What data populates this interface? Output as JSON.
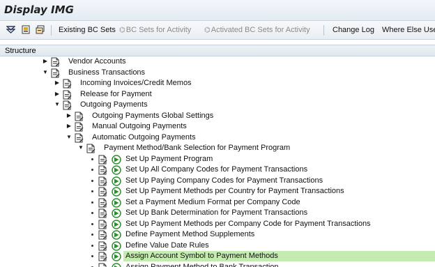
{
  "window": {
    "title": "Display IMG"
  },
  "toolbar": {
    "icons": [
      "expand-subtree-icon",
      "documentation-icon",
      "release-notes-icon"
    ],
    "buttons": [
      {
        "label": "Existing BC Sets",
        "enabled": true
      },
      {
        "label": "BC Sets for Activity",
        "enabled": false
      },
      {
        "label": "Activated BC Sets for Activity",
        "enabled": false
      },
      {
        "label": "Change Log",
        "enabled": true
      },
      {
        "label": "Where Else Used",
        "enabled": true
      }
    ]
  },
  "structure": {
    "header": "Structure",
    "nodes": [
      {
        "label": "Vendor Accounts",
        "level": 3,
        "state": "collapsed",
        "type": "folder"
      },
      {
        "label": "Business Transactions",
        "level": 3,
        "state": "expanded",
        "type": "folder"
      },
      {
        "label": "Incoming Invoices/Credit Memos",
        "level": 4,
        "state": "collapsed",
        "type": "folder"
      },
      {
        "label": "Release for Payment",
        "level": 4,
        "state": "collapsed",
        "type": "folder"
      },
      {
        "label": "Outgoing Payments",
        "level": 4,
        "state": "expanded",
        "type": "folder"
      },
      {
        "label": "Outgoing Payments Global Settings",
        "level": 5,
        "state": "collapsed",
        "type": "folder"
      },
      {
        "label": "Manual Outgoing Payments",
        "level": 5,
        "state": "collapsed",
        "type": "folder"
      },
      {
        "label": "Automatic Outgoing Payments",
        "level": 5,
        "state": "expanded",
        "type": "folder"
      },
      {
        "label": "Payment Method/Bank Selection for Payment Program",
        "level": 6,
        "state": "expanded",
        "type": "folder"
      },
      {
        "label": "Set Up Payment Program",
        "level": 7,
        "state": "leaf",
        "type": "activity"
      },
      {
        "label": "Set Up All Company Codes for Payment Transactions",
        "level": 7,
        "state": "leaf",
        "type": "activity"
      },
      {
        "label": "Set Up Paying Company Codes for Payment Transactions",
        "level": 7,
        "state": "leaf",
        "type": "activity"
      },
      {
        "label": "Set Up Payment Methods per Country for Payment Transactions",
        "level": 7,
        "state": "leaf",
        "type": "activity"
      },
      {
        "label": "Set a Payment Medium Format per Company Code",
        "level": 7,
        "state": "leaf",
        "type": "activity"
      },
      {
        "label": "Set Up Bank Determination for Payment Transactions",
        "level": 7,
        "state": "leaf",
        "type": "activity"
      },
      {
        "label": "Set Up Payment Methods per Company Code for Payment Transactions",
        "level": 7,
        "state": "leaf",
        "type": "activity"
      },
      {
        "label": "Define Payment Method Supplements",
        "level": 7,
        "state": "leaf",
        "type": "activity"
      },
      {
        "label": "Define Value Date Rules",
        "level": 7,
        "state": "leaf",
        "type": "activity"
      },
      {
        "label": "Assign Account Symbol to Payment Methods",
        "level": 7,
        "state": "leaf",
        "type": "activity",
        "selected": true
      },
      {
        "label": "Assign Payment Method to Bank Transaction",
        "level": 7,
        "state": "leaf",
        "type": "activity"
      }
    ]
  },
  "colors": {
    "selection": "#c4ecb0",
    "exec_icon": "#2f8d2f",
    "toolbar_bg": "#e9eef3"
  }
}
